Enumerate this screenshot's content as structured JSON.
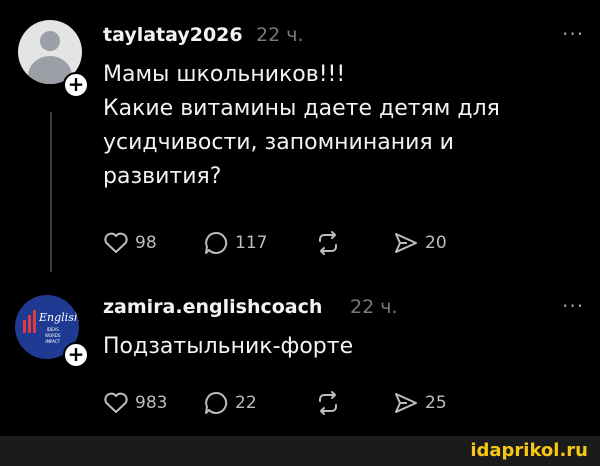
{
  "posts": [
    {
      "username": "taylatay2026",
      "time": "22 ч.",
      "text_lines": [
        "Мамы школьников!!!",
        "Какие витамины даете детям для",
        "усидчивости, запомнинания и",
        "развития?"
      ],
      "likes": "98",
      "comments": "117",
      "shares": "20",
      "avatar_icon": "default-avatar-icon"
    },
    {
      "username": "zamira.englishcoach",
      "time": "22 ч.",
      "text_lines": [
        "Подзатыльник-форте"
      ],
      "likes": "983",
      "comments": "22",
      "shares": "25",
      "avatar_icon": "english-logo-icon",
      "avatar_text": {
        "title": "English",
        "subtitle": [
          "IDEAS",
          "WORDS",
          "IMPACT"
        ]
      }
    }
  ],
  "more_label": "···",
  "watermark": "idaprikol.ru",
  "colors": {
    "background": "#000000",
    "text": "#f3f3f3",
    "muted": "#7a7a7a",
    "brand": "#f6c814",
    "avatar_blue": "#1f3a93"
  }
}
